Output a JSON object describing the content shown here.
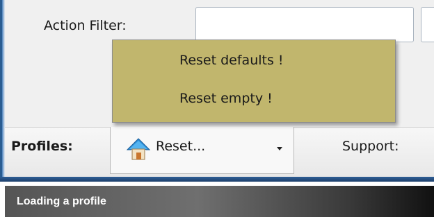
{
  "filter": {
    "action_filter_label": "Action Filter:",
    "action_filter_value": ""
  },
  "menu": {
    "items": [
      {
        "label": "Reset defaults !"
      },
      {
        "label": "Reset empty !"
      }
    ],
    "background_color": "#c1b66d"
  },
  "toolbar": {
    "profiles_label": "Profiles:",
    "reset_button_label": "Reset...",
    "reset_icon": "house-icon",
    "support_label": "Support:"
  },
  "caption": {
    "text": "Loading a profile"
  }
}
